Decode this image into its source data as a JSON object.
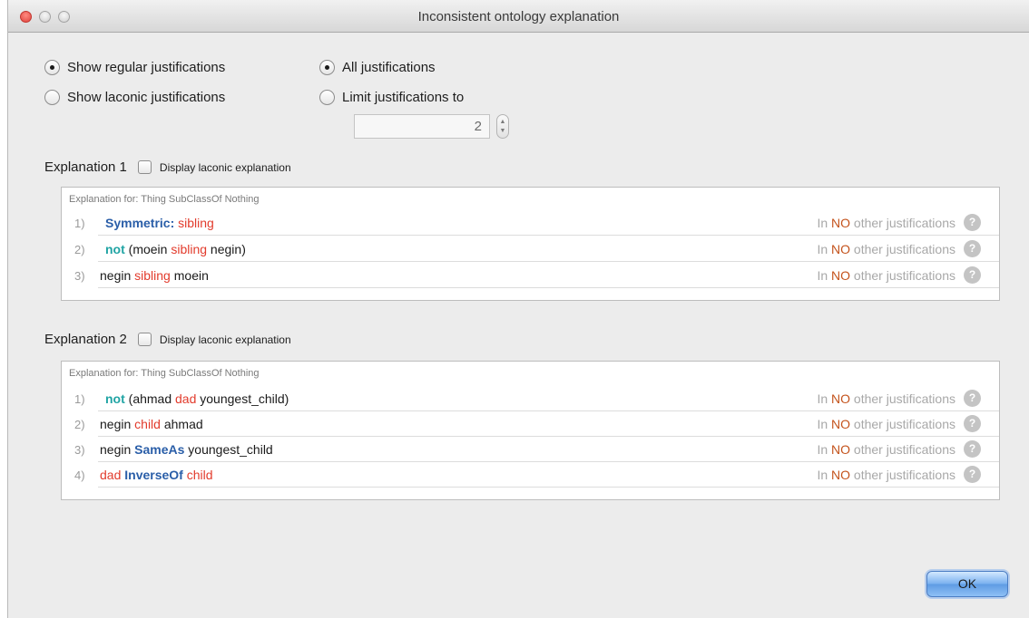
{
  "window": {
    "title": "Inconsistent ontology explanation"
  },
  "options": {
    "show_regular": "Show regular justifications",
    "show_laconic": "Show laconic justifications",
    "all_justifications": "All justifications",
    "limit_justifications": "Limit justifications to",
    "limit_value": "2"
  },
  "explanations": [
    {
      "title": "Explanation 1",
      "checkbox_label": "Display laconic explanation",
      "caption": "Explanation for: Thing SubClassOf Nothing",
      "rows": [
        {
          "num": "1)",
          "parts": [
            "Symmetric:",
            " ",
            "sibling"
          ]
        },
        {
          "num": "2)",
          "parts": [
            "not",
            " (moein ",
            "sibling",
            " negin)"
          ]
        },
        {
          "num": "3)",
          "parts": [
            "negin ",
            "sibling",
            " moein"
          ]
        }
      ]
    },
    {
      "title": "Explanation 2",
      "checkbox_label": "Display laconic explanation",
      "caption": "Explanation for: Thing SubClassOf Nothing",
      "rows": [
        {
          "num": "1)",
          "parts": [
            "not",
            " (ahmad ",
            "dad",
            " youngest_child)"
          ]
        },
        {
          "num": "2)",
          "parts": [
            "negin ",
            "child",
            " ahmad"
          ]
        },
        {
          "num": "3)",
          "parts": [
            "negin ",
            "SameAs",
            " youngest_child"
          ]
        },
        {
          "num": "4)",
          "parts": [
            "dad",
            " ",
            "InverseOf",
            " ",
            "child"
          ]
        }
      ]
    }
  ],
  "row_info": {
    "prefix": "In ",
    "no": "NO",
    "suffix": " other justifications",
    "help": "?"
  },
  "ok_button": "OK",
  "colors": {
    "keyword_blue": "#2a5ea8",
    "keyword_teal": "#20a4a4",
    "property_red": "#e23b2c",
    "no_orange": "#c4531c"
  }
}
